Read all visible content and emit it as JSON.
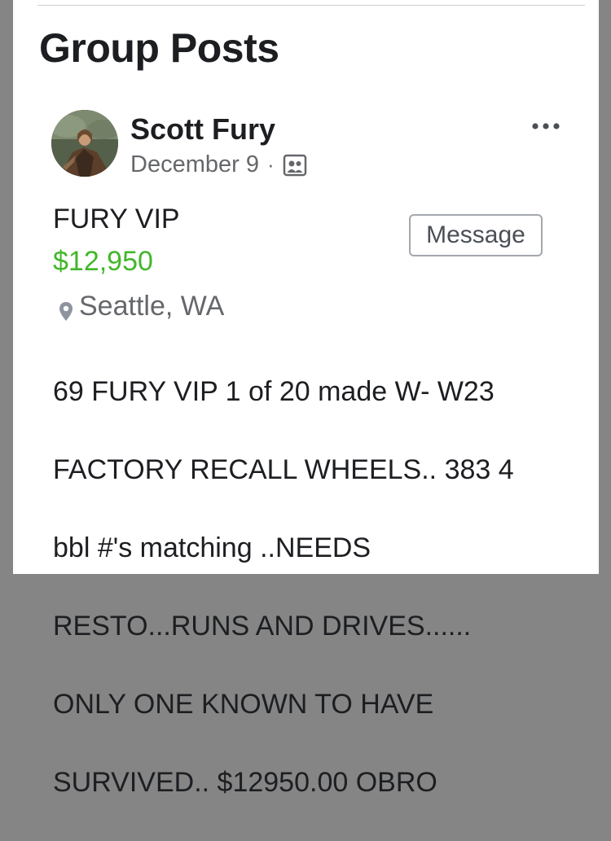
{
  "section": {
    "title": "Group Posts"
  },
  "post": {
    "author": "Scott Fury",
    "date": "December 9",
    "separator": "·",
    "audience_icon": "group-audience-icon",
    "more_icon": "more-options-icon"
  },
  "listing": {
    "title": "FURY VIP",
    "price": "$12,950",
    "location": "Seattle, WA",
    "location_icon": "map-pin-icon",
    "message_label": "Message",
    "description_lines": [
      "69 FURY VIP 1 of 20 made W- W23",
      "FACTORY RECALL WHEELS.. 383 4",
      "bbl #'s matching ..NEEDS",
      "RESTO...RUNS AND DRIVES......",
      "ONLY ONE KNOWN TO HAVE",
      "SURVIVED..  $12950.00 OBRO"
    ]
  },
  "colors": {
    "price": "#42b72a",
    "secondary_text": "#65676b",
    "primary_text": "#1c1e21",
    "backdrop": "#858585"
  }
}
